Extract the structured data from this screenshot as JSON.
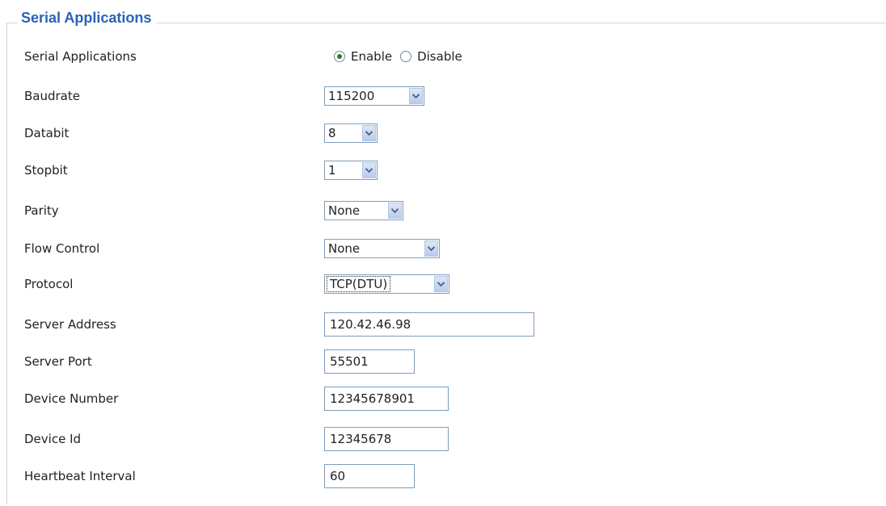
{
  "section": {
    "title": "Serial Applications"
  },
  "fields": {
    "serial_applications": {
      "label": "Serial Applications",
      "options": [
        "Enable",
        "Disable"
      ],
      "selected": "Enable"
    },
    "baudrate": {
      "label": "Baudrate",
      "value": "115200"
    },
    "databit": {
      "label": "Databit",
      "value": "8"
    },
    "stopbit": {
      "label": "Stopbit",
      "value": "1"
    },
    "parity": {
      "label": "Parity",
      "value": "None"
    },
    "flow_control": {
      "label": "Flow Control",
      "value": "None"
    },
    "protocol": {
      "label": "Protocol",
      "value": "TCP(DTU)"
    },
    "server_address": {
      "label": "Server Address",
      "value": "120.42.46.98"
    },
    "server_port": {
      "label": "Server Port",
      "value": "55501"
    },
    "device_number": {
      "label": "Device Number",
      "value": "12345678901"
    },
    "device_id": {
      "label": "Device Id",
      "value": "12345678"
    },
    "heartbeat_interval": {
      "label": "Heartbeat Interval",
      "value": "60"
    }
  },
  "icons": {
    "dropdown": "chevron-down-icon"
  },
  "colors": {
    "legend": "#2a63b5",
    "radio_selected": "#2c7a2c",
    "field_border": "#7f9db9"
  }
}
